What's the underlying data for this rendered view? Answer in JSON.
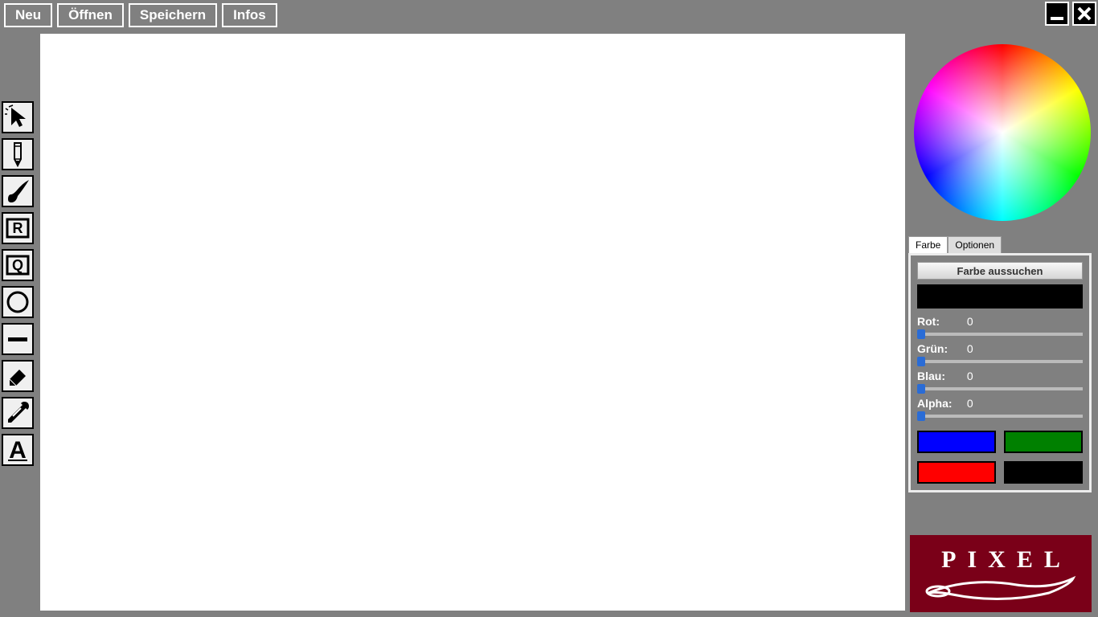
{
  "menu": {
    "new": "Neu",
    "open": "Öffnen",
    "save": "Speichern",
    "info": "Infos"
  },
  "tools": [
    "cursor",
    "pencil",
    "brush",
    "rect",
    "square-q",
    "ellipse",
    "line",
    "eraser",
    "eyedropper",
    "text"
  ],
  "tabs": {
    "color": "Farbe",
    "options": "Optionen"
  },
  "panel": {
    "pick_label": "Farbe aussuchen",
    "current_color": "#000000",
    "sliders": {
      "r": {
        "label": "Rot:",
        "value": 0
      },
      "g": {
        "label": "Grün:",
        "value": 0
      },
      "b": {
        "label": "Blau:",
        "value": 0
      },
      "a": {
        "label": "Alpha:",
        "value": 0
      }
    },
    "swatches": [
      "#0000ff",
      "#008000",
      "#ff0000",
      "#000000"
    ]
  },
  "logo": {
    "text": "PIXEL"
  }
}
